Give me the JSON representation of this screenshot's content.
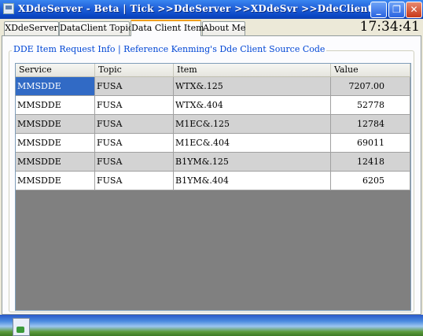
{
  "window": {
    "title": "XDdeServer - Beta | Tick >>DdeServer >>XDdeSvr >>DdeClient",
    "minimize_glyph": "_",
    "maximize_glyph": "❐",
    "close_glyph": "✕"
  },
  "tabs": [
    {
      "label": "XDdeServer",
      "active": false
    },
    {
      "label": "DataClient Topic",
      "active": false
    },
    {
      "label": "Data Client Item",
      "active": true
    },
    {
      "label": "About Me",
      "active": false
    }
  ],
  "clock": "17:34:41",
  "group": {
    "legend": "DDE Item Request Info | Reference Kenming's Dde Client Source Code"
  },
  "grid": {
    "columns": [
      "Service",
      "Topic",
      "Item",
      "Value"
    ],
    "rows": [
      {
        "service": "MMSDDE",
        "topic": "FUSA",
        "item": "WTX&.125",
        "value": "7207.00"
      },
      {
        "service": "MMSDDE",
        "topic": "FUSA",
        "item": "WTX&.404",
        "value": "52778"
      },
      {
        "service": "MMSDDE",
        "topic": "FUSA",
        "item": "M1EC&.125",
        "value": "12784"
      },
      {
        "service": "MMSDDE",
        "topic": "FUSA",
        "item": "M1EC&.404",
        "value": "69011"
      },
      {
        "service": "MMSDDE",
        "topic": "FUSA",
        "item": "B1YM&.125",
        "value": "12418"
      },
      {
        "service": "MMSDDE",
        "topic": "FUSA",
        "item": "B1YM&.404",
        "value": "6205"
      }
    ]
  },
  "colors": {
    "title_bar": "#0a46c4",
    "selection": "#316ac5",
    "legend_text": "#0046d5",
    "grid_background": "#808080",
    "odd_row": "#d3d3d3"
  }
}
